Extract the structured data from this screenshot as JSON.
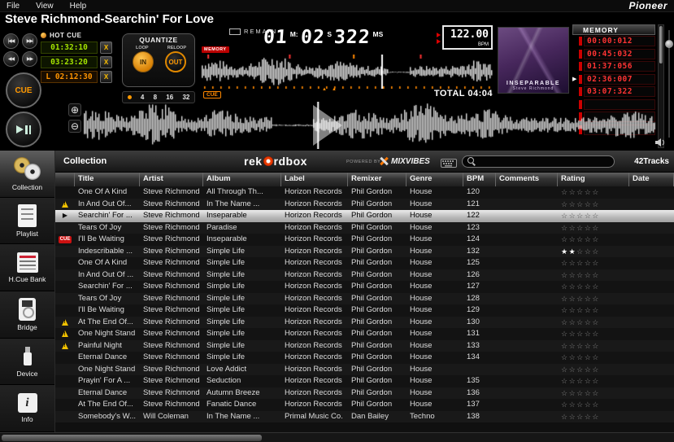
{
  "menu_bar": {
    "items": [
      "File",
      "View",
      "Help"
    ],
    "brand": "Pioneer"
  },
  "player": {
    "track_title": "Steve Richmond-Searchin' For Love",
    "transport_buttons": [
      {
        "icon": "prev-track-button",
        "glyph": "|◀◀"
      },
      {
        "icon": "next-track-button",
        "glyph": "▶▶|"
      },
      {
        "icon": "search-back-button",
        "glyph": "◀◀"
      },
      {
        "icon": "search-forward-button",
        "glyph": "▶▶"
      }
    ],
    "cue_button_label": "CUE",
    "hot_cue": {
      "label": "HOT CUE",
      "slots": [
        {
          "time": "01:32:10",
          "clear_label": "X",
          "style": "green"
        },
        {
          "time": "03:23:20",
          "clear_label": "X",
          "style": "green"
        },
        {
          "time": "L 02:12:30",
          "clear_label": "X",
          "style": "orange"
        }
      ]
    },
    "quantize": {
      "label": "QUANTIZE",
      "loop_label": "LOOP",
      "reloop_label": "RELOOP",
      "in_label": "IN",
      "out_label": "OUT",
      "beats": [
        "4",
        "8",
        "16",
        "32"
      ]
    },
    "display": {
      "remain_label": "REMAIN",
      "memory_tag": "MEMORY",
      "cue_tag": "CUE",
      "minutes": "01",
      "min_unit": "M:",
      "seconds": "02",
      "sec_unit": "S",
      "millis": "322",
      "ms_unit": "MS",
      "bpm_value": "122.00",
      "bpm_label": "BPM",
      "total_label": "TOTAL 04:04"
    },
    "album_art": {
      "caption": "INSEPARABLE",
      "subcaption": "Steve Richmond"
    },
    "memory_panel": {
      "label": "MEMORY",
      "entries": [
        "00:00:012",
        "00:45:032",
        "01:37:056",
        "02:36:007",
        "03:07:322",
        "",
        "",
        ""
      ],
      "active_index": 3
    }
  },
  "browser": {
    "sidebar": [
      {
        "label": "Collection",
        "icon": "discs-icon",
        "selected": true
      },
      {
        "label": "Playlist",
        "icon": "playlist-icon",
        "selected": false
      },
      {
        "label": "H.Cue Bank",
        "icon": "cue-bank-icon",
        "selected": false
      },
      {
        "label": "Bridge",
        "icon": "bridge-icon",
        "selected": false
      },
      {
        "label": "Device",
        "icon": "device-icon",
        "selected": false
      },
      {
        "label": "Info",
        "icon": "info-icon",
        "selected": false
      }
    ],
    "header": {
      "title": "Collection",
      "logo_pre": "rek",
      "logo_post": "rdbox",
      "powered_by": "POWERED BY",
      "partner_logo": "MIXVIBES",
      "search_value": "",
      "track_count": "42Tracks"
    },
    "cue_badge_label": "CUE",
    "columns": [
      "Title",
      "Artist",
      "Album",
      "Label",
      "Remixer",
      "Genre",
      "BPM",
      "Comments",
      "Rating",
      "Date"
    ],
    "rows": [
      {
        "status": "",
        "title": "One Of A Kind",
        "artist": "Steve Richmond",
        "album": "All Through Th...",
        "label": "Horizon Records",
        "remixer": "Phil Gordon",
        "genre": "House",
        "bpm": "120",
        "comments": "",
        "rating": 0,
        "date": "",
        "selected": false
      },
      {
        "status": "warning",
        "title": "In And Out Of...",
        "artist": "Steve Richmond",
        "album": "In The Name ...",
        "label": "Horizon Records",
        "remixer": "Phil Gordon",
        "genre": "House",
        "bpm": "121",
        "comments": "",
        "rating": 0,
        "date": "",
        "selected": false
      },
      {
        "status": "playing",
        "title": "Searchin' For ...",
        "artist": "Steve Richmond",
        "album": "Inseparable",
        "label": "Horizon Records",
        "remixer": "Phil Gordon",
        "genre": "House",
        "bpm": "122",
        "comments": "",
        "rating": 0,
        "date": "",
        "selected": true
      },
      {
        "status": "",
        "title": "Tears Of Joy",
        "artist": "Steve Richmond",
        "album": "Paradise",
        "label": "Horizon Records",
        "remixer": "Phil Gordon",
        "genre": "House",
        "bpm": "123",
        "comments": "",
        "rating": 0,
        "date": "",
        "selected": false
      },
      {
        "status": "cue",
        "title": "I'll Be Waiting",
        "artist": "Steve Richmond",
        "album": "Inseparable",
        "label": "Horizon Records",
        "remixer": "Phil Gordon",
        "genre": "House",
        "bpm": "124",
        "comments": "",
        "rating": 0,
        "date": "",
        "selected": false
      },
      {
        "status": "",
        "title": "Indescribable ...",
        "artist": "Steve Richmond",
        "album": "Simple Life",
        "label": "Horizon Records",
        "remixer": "Phil Gordon",
        "genre": "House",
        "bpm": "132",
        "comments": "",
        "rating": 2,
        "date": "",
        "selected": false
      },
      {
        "status": "",
        "title": "One Of A Kind",
        "artist": "Steve Richmond",
        "album": "Simple Life",
        "label": "Horizon Records",
        "remixer": "Phil Gordon",
        "genre": "House",
        "bpm": "125",
        "comments": "",
        "rating": 0,
        "date": "",
        "selected": false
      },
      {
        "status": "",
        "title": "In And Out Of ...",
        "artist": "Steve Richmond",
        "album": "Simple Life",
        "label": "Horizon Records",
        "remixer": "Phil Gordon",
        "genre": "House",
        "bpm": "126",
        "comments": "",
        "rating": 0,
        "date": "",
        "selected": false
      },
      {
        "status": "",
        "title": "Searchin' For ...",
        "artist": "Steve Richmond",
        "album": "Simple Life",
        "label": "Horizon Records",
        "remixer": "Phil Gordon",
        "genre": "House",
        "bpm": "127",
        "comments": "",
        "rating": 0,
        "date": "",
        "selected": false
      },
      {
        "status": "",
        "title": "Tears Of Joy",
        "artist": "Steve Richmond",
        "album": "Simple Life",
        "label": "Horizon Records",
        "remixer": "Phil Gordon",
        "genre": "House",
        "bpm": "128",
        "comments": "",
        "rating": 0,
        "date": "",
        "selected": false
      },
      {
        "status": "",
        "title": "I'll Be Waiting",
        "artist": "Steve Richmond",
        "album": "Simple Life",
        "label": "Horizon Records",
        "remixer": "Phil Gordon",
        "genre": "House",
        "bpm": "129",
        "comments": "",
        "rating": 0,
        "date": "",
        "selected": false
      },
      {
        "status": "warning",
        "title": "At The End Of...",
        "artist": "Steve Richmond",
        "album": "Simple Life",
        "label": "Horizon Records",
        "remixer": "Phil Gordon",
        "genre": "House",
        "bpm": "130",
        "comments": "",
        "rating": 0,
        "date": "",
        "selected": false
      },
      {
        "status": "warning",
        "title": "One Night Stand",
        "artist": "Steve Richmond",
        "album": "Simple Life",
        "label": "Horizon Records",
        "remixer": "Phil Gordon",
        "genre": "House",
        "bpm": "131",
        "comments": "",
        "rating": 0,
        "date": "",
        "selected": false
      },
      {
        "status": "warning",
        "title": "Painful Night",
        "artist": "Steve Richmond",
        "album": "Simple Life",
        "label": "Horizon Records",
        "remixer": "Phil Gordon",
        "genre": "House",
        "bpm": "133",
        "comments": "",
        "rating": 0,
        "date": "",
        "selected": false
      },
      {
        "status": "",
        "title": "Eternal Dance",
        "artist": "Steve Richmond",
        "album": "Simple Life",
        "label": "Horizon Records",
        "remixer": "Phil Gordon",
        "genre": "House",
        "bpm": "134",
        "comments": "",
        "rating": 0,
        "date": "",
        "selected": false
      },
      {
        "status": "",
        "title": "One Night Stand",
        "artist": "Steve Richmond",
        "album": "Love Addict",
        "label": "Horizon Records",
        "remixer": "Phil Gordon",
        "genre": "House",
        "bpm": "",
        "comments": "",
        "rating": 0,
        "date": "",
        "selected": false
      },
      {
        "status": "",
        "title": "Prayin' For A ...",
        "artist": "Steve Richmond",
        "album": "Seduction",
        "label": "Horizon Records",
        "remixer": "Phil Gordon",
        "genre": "House",
        "bpm": "135",
        "comments": "",
        "rating": 0,
        "date": "",
        "selected": false
      },
      {
        "status": "",
        "title": "Eternal Dance",
        "artist": "Steve Richmond",
        "album": "Autumn Breeze",
        "label": "Horizon Records",
        "remixer": "Phil Gordon",
        "genre": "House",
        "bpm": "136",
        "comments": "",
        "rating": 0,
        "date": "",
        "selected": false
      },
      {
        "status": "",
        "title": "At The End Of...",
        "artist": "Steve Richmond",
        "album": "Fanatic Dance",
        "label": "Horizon Records",
        "remixer": "Phil Gordon",
        "genre": "House",
        "bpm": "137",
        "comments": "",
        "rating": 0,
        "date": "",
        "selected": false
      },
      {
        "status": "",
        "title": "Somebody's W...",
        "artist": "Will Coleman",
        "album": "In The Name ...",
        "label": "Primal Music Co.",
        "remixer": "Dan Bailey",
        "genre": "Techno",
        "bpm": "138",
        "comments": "",
        "rating": 0,
        "date": "",
        "selected": false
      }
    ]
  },
  "colors": {
    "accent_orange": "#ff9900",
    "lcd_green": "#a4e400",
    "memory_red": "#cc0000",
    "selected_row": "#c0c0c0"
  }
}
